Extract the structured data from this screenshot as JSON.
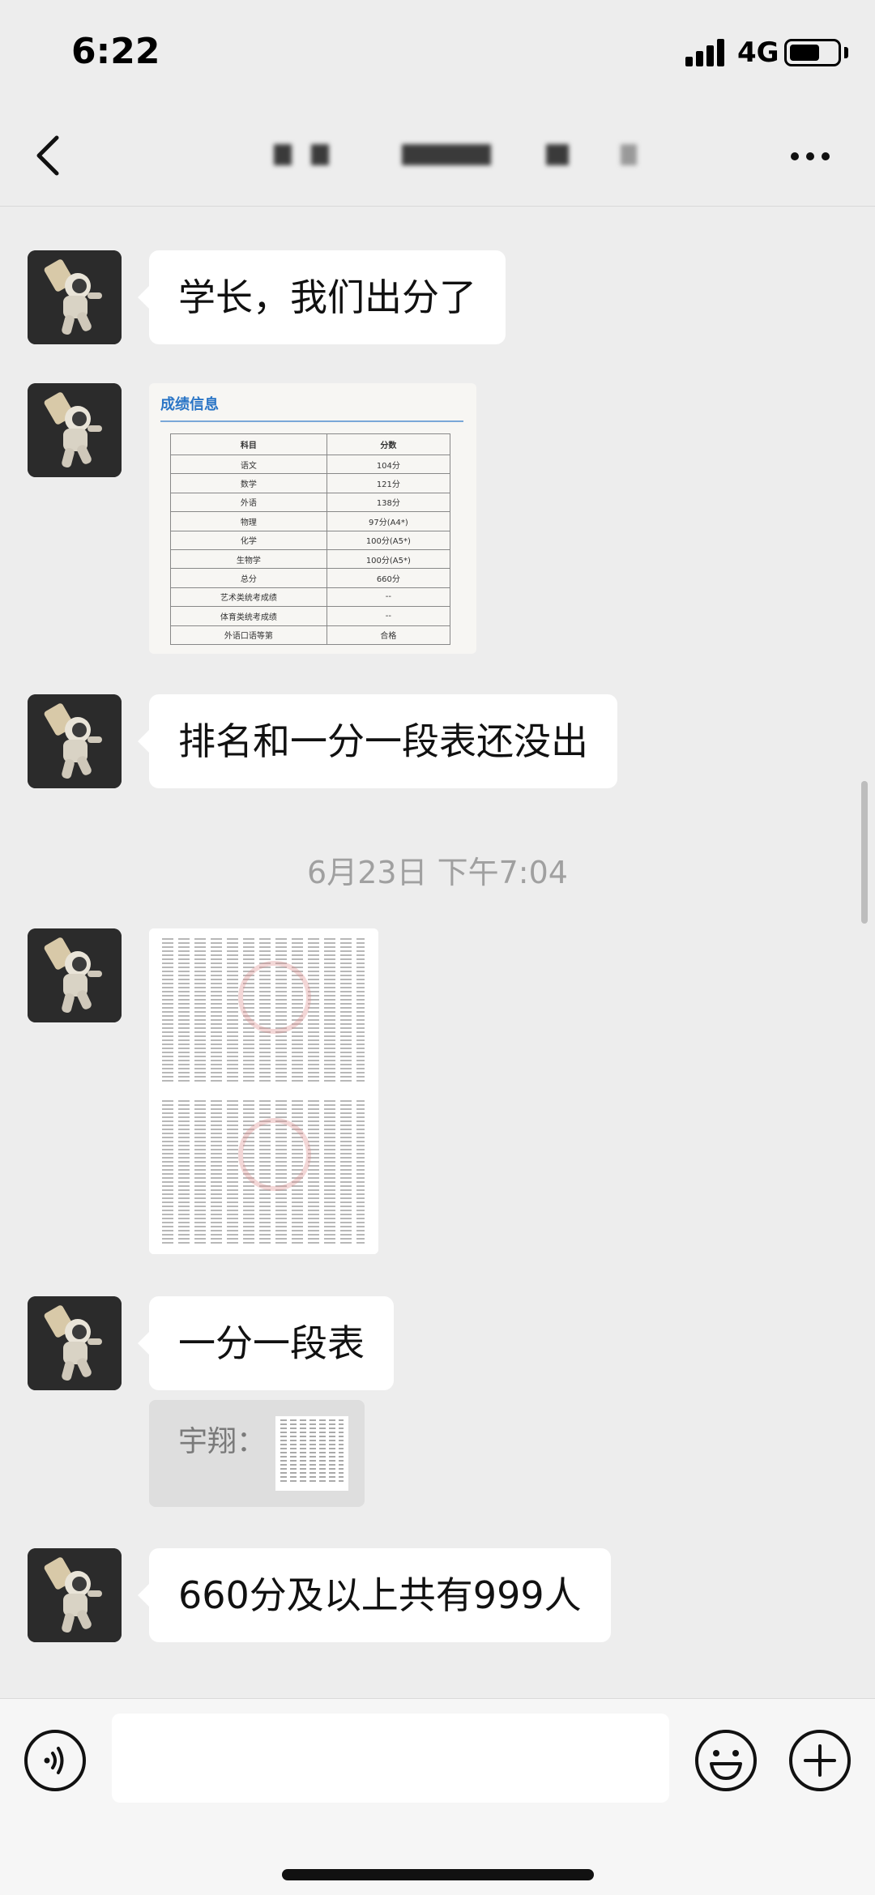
{
  "status_bar": {
    "time": "6:22",
    "network": "4G",
    "battery_level": 0.65
  },
  "nav": {
    "back_icon": "chevron-left-icon",
    "more_icon": "more-dots-icon"
  },
  "messages": [
    {
      "type": "text",
      "text": "学长，我们出分了"
    },
    {
      "type": "image",
      "image": {
        "title": "成绩信息",
        "headers": [
          "科目",
          "分数"
        ],
        "rows": [
          [
            "语文",
            "104分"
          ],
          [
            "数学",
            "121分"
          ],
          [
            "外语",
            "138分"
          ],
          [
            "物理",
            "97分(A4*)"
          ],
          [
            "化学",
            "100分(A5*)"
          ],
          [
            "生物学",
            "100分(A5*)"
          ],
          [
            "总分",
            "660分"
          ],
          [
            "艺术类统考成绩",
            "--"
          ],
          [
            "体育类统考成绩",
            "--"
          ],
          [
            "外语口语等第",
            "合格"
          ]
        ]
      }
    },
    {
      "type": "text",
      "text": "排名和一分一段表还没出"
    },
    {
      "type": "timestamp",
      "text": "6月23日 下午7:04"
    },
    {
      "type": "image",
      "image": {
        "description_hidden": true
      }
    },
    {
      "type": "text",
      "text": "一分一段表"
    },
    {
      "type": "quote",
      "author": "宇翔："
    },
    {
      "type": "text",
      "text": "660分及以上共有999人"
    }
  ],
  "input_bar": {
    "voice_icon": "voice-icon",
    "emoji_icon": "emoji-icon",
    "plus_icon": "plus-icon",
    "text_value": ""
  },
  "colors": {
    "background": "#ededed",
    "bubble": "#ffffff",
    "timestamp": "#a0a0a0",
    "score_title": "#2a75c6"
  }
}
